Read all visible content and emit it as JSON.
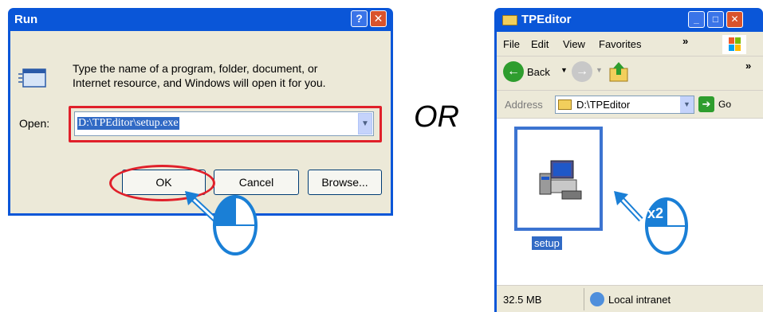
{
  "run_dialog": {
    "title": "Run",
    "help_glyph": "?",
    "close_glyph": "✕",
    "description": "Type the name of a program, folder, document, or\nInternet resource, and Windows will open it for you.",
    "open_label": "Open:",
    "open_value": "D:\\TPEditor\\setup.exe",
    "buttons": {
      "ok": "OK",
      "cancel": "Cancel",
      "browse": "Browse..."
    }
  },
  "separator": {
    "text": "OR"
  },
  "explorer": {
    "title": "TPEditor",
    "menu": [
      "File",
      "Edit",
      "View",
      "Favorites"
    ],
    "menu_more": "»",
    "toolbar_more": "»",
    "back_label": "Back",
    "address_label": "Address",
    "address_value": "D:\\TPEditor",
    "go_label": "Go",
    "file_label": "setup",
    "status_size": "32.5 MB",
    "status_zone": "Local intranet"
  },
  "annotations": {
    "double_click_badge": "x2"
  },
  "colors": {
    "titlebar": "#0a56d8",
    "highlight_red": "#e0202a",
    "selection_blue": "#3c74d1",
    "mouse_blue": "#1a7fd6"
  }
}
